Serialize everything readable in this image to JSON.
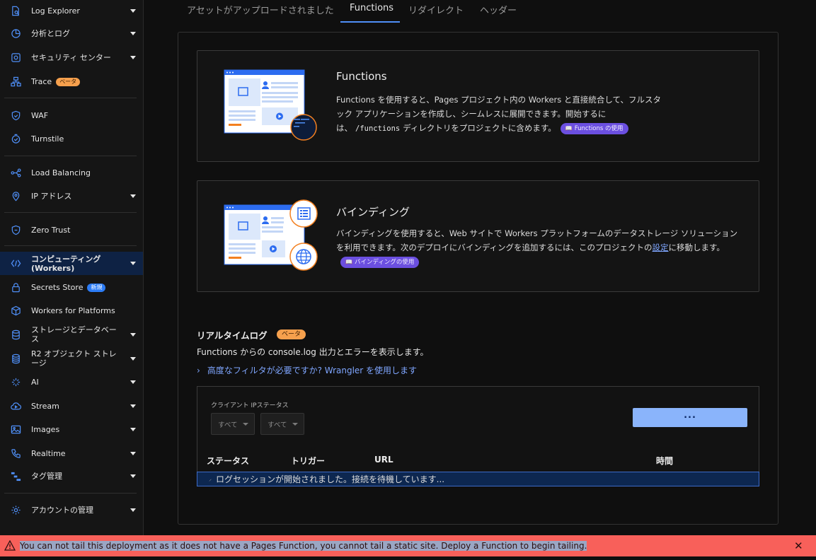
{
  "sidebar": {
    "items": [
      {
        "label": "Log Explorer",
        "icon": "document-search-icon",
        "chevron": true
      },
      {
        "label": "分析とログ",
        "icon": "chart-pie-icon",
        "chevron": true
      },
      {
        "label": "セキュリティ センター",
        "icon": "security-center-icon",
        "chevron": true
      },
      {
        "label": "Trace",
        "icon": "trace-icon",
        "chevron": false,
        "badge": "ベータ"
      },
      {
        "label": "WAF",
        "icon": "shield-icon",
        "chevron": false
      },
      {
        "label": "Turnstile",
        "icon": "turnstile-icon",
        "chevron": false
      },
      {
        "label": "Load Balancing",
        "icon": "load-balancing-icon",
        "chevron": false
      },
      {
        "label": "IP アドレス",
        "icon": "location-pin-icon",
        "chevron": true
      },
      {
        "label": "Zero Trust",
        "icon": "zero-trust-icon",
        "chevron": false
      },
      {
        "label": "コンピューティング (Workers)",
        "label_line1": "コンピューティング",
        "label_line2": "(Workers)",
        "icon": "workers-icon",
        "chevron": true,
        "active": true
      },
      {
        "label": "Secrets Store",
        "icon": "lock-icon",
        "chevron": false,
        "badge": "新規"
      },
      {
        "label": "Workers for Platforms",
        "icon": "cube-icon",
        "chevron": false
      },
      {
        "label": "ストレージとデータベース",
        "label_line1": "ストレージとデータベー",
        "label_line2": "ス",
        "icon": "database-icon",
        "chevron": true
      },
      {
        "label": "R2 オブジェクト ストレージ",
        "label_line1": "R2 オブジェクト ストレ",
        "label_line2": "ージ",
        "icon": "storage-icon",
        "chevron": true
      },
      {
        "label": "AI",
        "icon": "ai-sparkle-icon",
        "chevron": true
      },
      {
        "label": "Stream",
        "icon": "stream-cloud-icon",
        "chevron": true
      },
      {
        "label": "Images",
        "icon": "image-icon",
        "chevron": true
      },
      {
        "label": "Realtime",
        "icon": "phone-icon",
        "chevron": true
      },
      {
        "label": "タグ管理",
        "icon": "tag-manager-icon",
        "chevron": true
      },
      {
        "label": "アカウントの管理",
        "icon": "gear-icon",
        "chevron": true
      }
    ]
  },
  "tabs": [
    {
      "label": "アセットがアップロードされました",
      "active": false
    },
    {
      "label": "Functions",
      "active": true
    },
    {
      "label": "リダイレクト",
      "active": false
    },
    {
      "label": "ヘッダー",
      "active": false
    }
  ],
  "functions_card": {
    "title": "Functions",
    "desc_1": "Functions を使用すると、Pages プロジェクト内の Workers と直接統合して、フルスタック アプリケーションを作成し、シームレスに展開できます。開始するには、",
    "code": "/functions",
    "desc_2": "ディレクトリをプロジェクトに含めます。",
    "pill": "Functions の使用"
  },
  "bindings_card": {
    "title": "バインディング",
    "desc_1": "バインディングを使用すると、Web サイトで Workers プラットフォームのデータストレージ ソリューションを利用できます。次のデプロイにバインディングを追加するには、このプロジェクトの",
    "link": "設定",
    "desc_2": "に移動します。",
    "pill": "バインディングの使用"
  },
  "realtime_logs": {
    "title": "リアルタイムログ",
    "badge": "ベータ",
    "description": "Functions からの console.log 出力とエラーを表示します。",
    "advanced_link": "高度なフィルタが必要ですか? Wrangler を使用します",
    "filter_label": "クライアント IPステータス",
    "filter_ip_value": "すべて",
    "filter_status_value": "すべて",
    "more_button": "...",
    "columns": [
      "ステータス",
      "トリガー",
      "URL",
      "時間"
    ],
    "log_message": "ログセッションが開始されました。接続を待機しています..."
  },
  "error_banner": {
    "message": "You can not tail this deployment as it does not have a Pages Function, you cannot tail a static site. Deploy a Function to begin tailing.",
    "close": "✕",
    "color": "#f8605a"
  },
  "colors": {
    "accent": "#4f8ff7",
    "pill": "#6b4fe0",
    "badge_orange": "#f6a04d",
    "badge_blue": "#2c7cf6"
  }
}
